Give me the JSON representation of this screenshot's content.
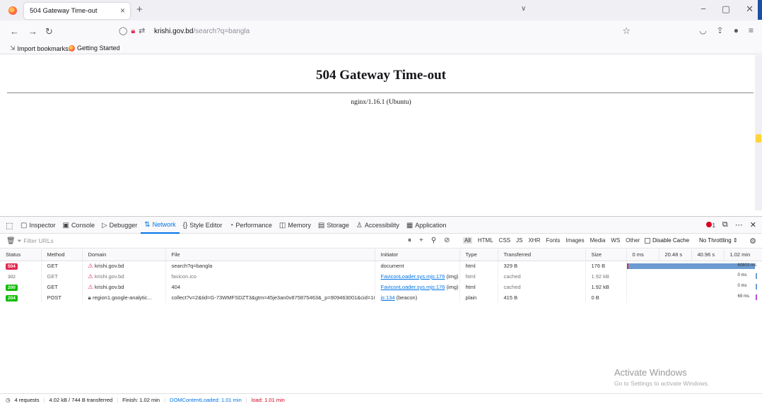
{
  "browser": {
    "tab_title": "504 Gateway Time-out",
    "tab_close": "×",
    "new_tab": "+",
    "tabs_list": "∨",
    "window_controls": [
      "−",
      "▢",
      "✕"
    ],
    "url_domain": "krishi.gov.bd",
    "url_path": "/search?q=bangla",
    "bookmarks": [
      "Import bookmarks...",
      "Getting Started"
    ]
  },
  "page": {
    "heading": "504 Gateway Time-out",
    "server": "nginx/1.16.1 (Ubuntu)"
  },
  "devtools": {
    "tabs": [
      {
        "icon": "▢",
        "label": "Inspector"
      },
      {
        "icon": "▣",
        "label": "Console"
      },
      {
        "icon": "▷",
        "label": "Debugger"
      },
      {
        "icon": "⇅",
        "label": "Network",
        "active": true
      },
      {
        "icon": "{}",
        "label": "Style Editor"
      },
      {
        "icon": "◔",
        "label": "Performance"
      },
      {
        "icon": "◫",
        "label": "Memory"
      },
      {
        "icon": "▤",
        "label": "Storage"
      },
      {
        "icon": "♙",
        "label": "Accessibility"
      },
      {
        "icon": "▦",
        "label": "Application"
      }
    ],
    "error_count": "1",
    "filter_placeholder": "Filter URLs",
    "type_filters": [
      "All",
      "HTML",
      "CSS",
      "JS",
      "XHR",
      "Fonts",
      "Images",
      "Media",
      "WS",
      "Other"
    ],
    "disable_cache": "Disable Cache",
    "throttling": "No Throttling ⇕",
    "columns": [
      "Status",
      "Method",
      "Domain",
      "File",
      "Initiator",
      "Type",
      "Transferred",
      "Size",
      "0 ms",
      "20.48 s",
      "40.96 s",
      "1.02 min"
    ],
    "requests": [
      {
        "status": "504",
        "method": "GET",
        "domain": "krishi.gov.bd",
        "file": "search?q=bangla",
        "initiator": "document",
        "type": "html",
        "transferred": "329 B",
        "size": "176 B",
        "timing": "60803 ms",
        "bar_start": 0,
        "bar_fraction": 0.98,
        "bar_color": "#6c9bd2"
      },
      {
        "status": "302",
        "method": "GET",
        "domain": "krishi.gov.bd",
        "file": "favicon.ico",
        "initiator": "FaviconLoader.sys.mjs:176",
        "initiator_suffix": " (img)",
        "type": "html",
        "transferred": "cached",
        "size": "1.92 kB",
        "timing": "0 ms",
        "bar_start": 0.985,
        "bar_fraction": 0.0,
        "bar_color": "#6c9bd2"
      },
      {
        "status": "200",
        "method": "GET",
        "domain": "krishi.gov.bd",
        "file": "404",
        "initiator": "FaviconLoader.sys.mjs:176",
        "initiator_suffix": " (img)",
        "type": "html",
        "transferred": "cached",
        "size": "1.92 kB",
        "timing": "0 ms",
        "bar_start": 0.985,
        "bar_fraction": 0.0,
        "bar_color": "#6c9bd2"
      },
      {
        "status": "204",
        "method": "POST",
        "domain": "region1.google-analytic...",
        "file": "collect?v=2&tid=G-73WMFSDZT3&gtm=45je3an0v875875463&_p=909463001&cid=1C",
        "initiator": "js:134",
        "initiator_suffix": " (beacon)",
        "type": "plain",
        "transferred": "415 B",
        "size": "0 B",
        "timing": "69 ms",
        "bar_start": 0.985,
        "bar_fraction": 0.004,
        "bar_color": "#b64dd6"
      }
    ],
    "summary": {
      "requests": "4 requests",
      "transferred": "4.02 kB / 744 B transferred",
      "finish": "Finish: 1.02 min",
      "dcl": "DOMContentLoaded: 1.01 min",
      "load": "load: 1.01 min"
    }
  },
  "watermark": {
    "title": "Activate Windows",
    "subtitle": "Go to Settings to activate Windows."
  }
}
